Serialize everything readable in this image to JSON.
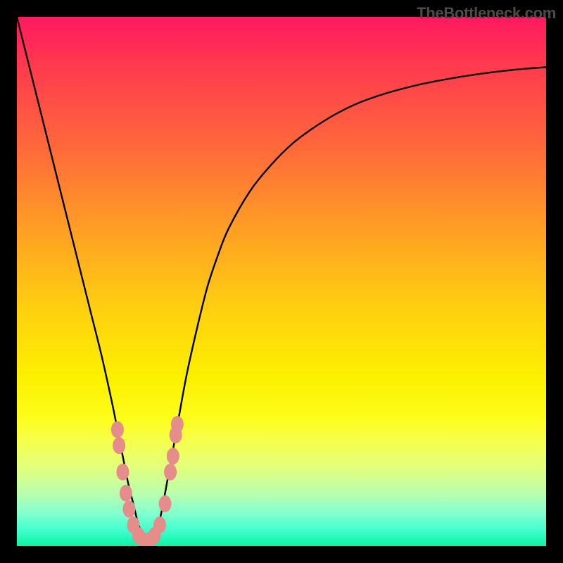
{
  "watermark": "TheBottleneck.com",
  "colors": {
    "curve": "#000000",
    "marker_fill": "#e48d8a",
    "marker_stroke": "#c96f6c",
    "background": "#000000"
  },
  "chart_data": {
    "type": "line",
    "title": "",
    "xlabel": "",
    "ylabel": "",
    "xlim": [
      0,
      100
    ],
    "ylim": [
      0,
      100
    ],
    "x": [
      0,
      2,
      4,
      6,
      8,
      10,
      12,
      14,
      16,
      18,
      19,
      20,
      21,
      22,
      23,
      24,
      25,
      26,
      27,
      28,
      30,
      32,
      34,
      36,
      38,
      40,
      44,
      48,
      52,
      56,
      60,
      64,
      68,
      72,
      76,
      80,
      84,
      88,
      92,
      96,
      100
    ],
    "y": [
      100,
      92,
      84,
      76,
      68,
      60,
      52,
      44,
      36,
      27,
      22,
      17,
      12,
      8,
      4,
      2,
      1,
      2,
      5,
      10,
      21,
      32,
      41,
      49,
      55,
      60,
      67,
      72,
      76,
      79,
      81.5,
      83.5,
      85,
      86.2,
      87.2,
      88,
      88.7,
      89.3,
      89.8,
      90.2,
      90.5
    ],
    "marker_points": [
      {
        "x": 19.0,
        "y": 22
      },
      {
        "x": 19.3,
        "y": 19
      },
      {
        "x": 20.0,
        "y": 14
      },
      {
        "x": 20.6,
        "y": 10
      },
      {
        "x": 21.2,
        "y": 7
      },
      {
        "x": 22.0,
        "y": 4
      },
      {
        "x": 23.0,
        "y": 2
      },
      {
        "x": 24.0,
        "y": 1
      },
      {
        "x": 25.0,
        "y": 1
      },
      {
        "x": 26.0,
        "y": 2
      },
      {
        "x": 27.0,
        "y": 4
      },
      {
        "x": 28.0,
        "y": 8
      },
      {
        "x": 29.0,
        "y": 14
      },
      {
        "x": 29.5,
        "y": 17
      },
      {
        "x": 30.0,
        "y": 21
      },
      {
        "x": 30.3,
        "y": 23
      }
    ]
  }
}
